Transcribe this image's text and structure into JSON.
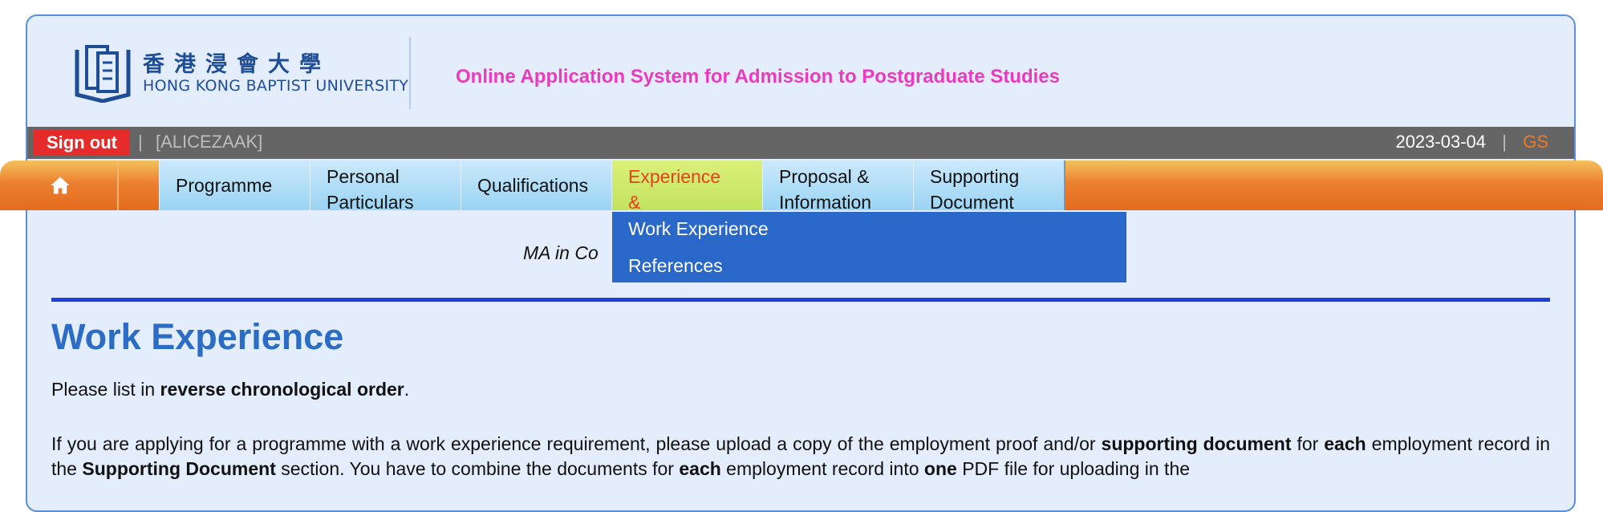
{
  "header": {
    "logo_cn": "香港浸會大學",
    "logo_en": "HONG KONG BAPTIST UNIVERSITY",
    "system_title": "Online Application System for Admission to Postgraduate Studies"
  },
  "userbar": {
    "signout_label": "Sign out",
    "separator": "|",
    "username": "[ALICEZAAK]",
    "date": "2023-03-04",
    "role": "GS"
  },
  "nav": {
    "tabs": [
      {
        "line1": "Programme",
        "line2": ""
      },
      {
        "line1": "Personal",
        "line2": "Particulars"
      },
      {
        "line1": "Qualifications",
        "line2": ""
      },
      {
        "line1": "Experience",
        "line2": "&"
      },
      {
        "line1": "Proposal &",
        "line2": "Information"
      },
      {
        "line1": "Supporting",
        "line2": "Document"
      }
    ],
    "dropdown": [
      "Work Experience",
      "References"
    ]
  },
  "content": {
    "programme": "MA in Co",
    "title": "Work Experience",
    "p1": {
      "a": "Please list in ",
      "b": "reverse chronological order",
      "c": "."
    },
    "p2": {
      "t1": "If you are applying for a programme with a work experience requirement, please upload a copy of the employment proof and/or ",
      "b1": "supporting document",
      "t2": " for ",
      "b2": "each",
      "t3": " employment record in the ",
      "b3": "Supporting Document",
      "t4": " section. You have to combine the documents for ",
      "b4": "each",
      "t5": " employment record into ",
      "b5": "one",
      "t6": " PDF file for uploading in the"
    }
  },
  "colors": {
    "title_pink": "#e83cbf",
    "signout_red": "#e62b2b",
    "active_tab_text": "#e8401c",
    "dropdown_blue": "#2968c8",
    "heading_blue": "#2b6cc4"
  }
}
